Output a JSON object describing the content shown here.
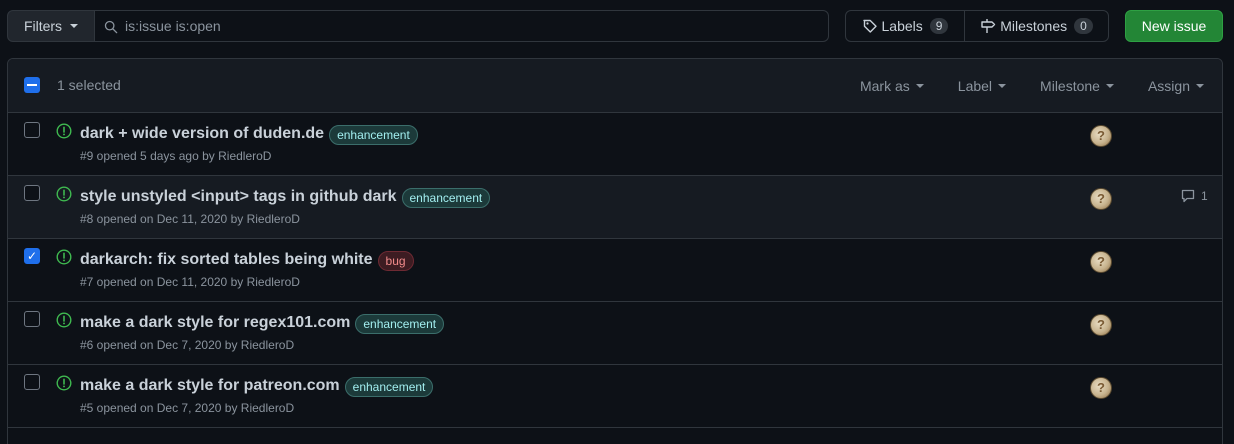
{
  "toolbar": {
    "filters_label": "Filters",
    "search_value": "is:issue is:open",
    "labels_label": "Labels",
    "labels_count": "9",
    "milestones_label": "Milestones",
    "milestones_count": "0",
    "new_issue_label": "New issue"
  },
  "header": {
    "selected_text": "1 selected",
    "menus": [
      "Mark as",
      "Label",
      "Milestone",
      "Assign"
    ]
  },
  "issues": [
    {
      "title": "dark + wide version of duden.de",
      "label": "enhancement",
      "label_kind": "enhancement",
      "meta": "#9 opened 5 days ago by RiedleroD",
      "checked": false,
      "comments": ""
    },
    {
      "title": "style unstyled <input> tags in github dark",
      "label": "enhancement",
      "label_kind": "enhancement",
      "meta": "#8 opened on Dec 11, 2020 by RiedleroD",
      "checked": false,
      "comments": "1"
    },
    {
      "title": "darkarch: fix sorted tables being white",
      "label": "bug",
      "label_kind": "bug",
      "meta": "#7 opened on Dec 11, 2020 by RiedleroD",
      "checked": true,
      "comments": ""
    },
    {
      "title": "make a dark style for regex101.com",
      "label": "enhancement",
      "label_kind": "enhancement",
      "meta": "#6 opened on Dec 7, 2020 by RiedleroD",
      "checked": false,
      "comments": ""
    },
    {
      "title": "make a dark style for patreon.com",
      "label": "enhancement",
      "label_kind": "enhancement",
      "meta": "#5 opened on Dec 7, 2020 by RiedleroD",
      "checked": false,
      "comments": ""
    }
  ],
  "colors": {
    "accent": "#1f6feb",
    "open_issue": "#3fb950",
    "primary_button": "#238636"
  }
}
